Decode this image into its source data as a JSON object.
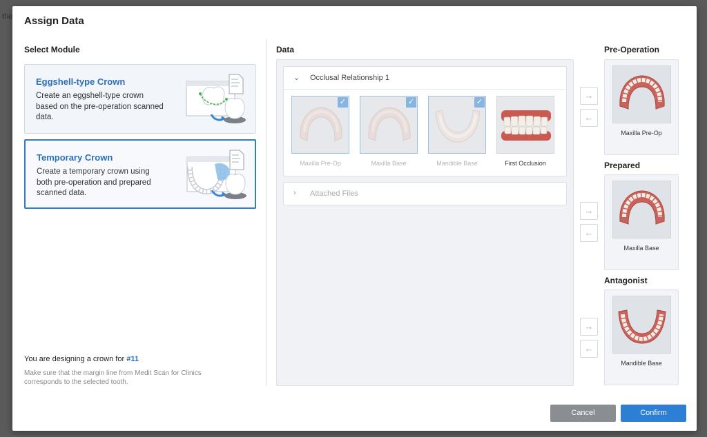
{
  "background": {
    "text": "the"
  },
  "dialog": {
    "title": "Assign Data",
    "select_module": {
      "heading": "Select Module",
      "modules": [
        {
          "name": "Eggshell-type Crown",
          "description": "Create an eggshell-type crown based on the pre-operation scanned data.",
          "selected": false
        },
        {
          "name": "Temporary Crown",
          "description": "Create a temporary crown using both pre-operation and prepared scanned data.",
          "selected": true
        }
      ],
      "designing_prefix": "You are designing a crown for ",
      "tooth": "#11",
      "note": "Make sure that the margin line from Medit Scan for Clinics corresponds to the selected tooth."
    },
    "data": {
      "heading": "Data",
      "groups": [
        {
          "label": "Occlusal Relationship 1",
          "expanded": true,
          "items": [
            {
              "label": "Maxilla Pre-Op",
              "checked": true
            },
            {
              "label": "Maxilla Base",
              "checked": true
            },
            {
              "label": "Mandible Base",
              "checked": true
            },
            {
              "label": "First Occlusion",
              "checked": false
            }
          ]
        },
        {
          "label": "Attached Files",
          "expanded": false
        }
      ]
    },
    "slots": [
      {
        "heading": "Pre-Operation",
        "assigned": "Maxilla Pre-Op"
      },
      {
        "heading": "Prepared",
        "assigned": "Maxilla Base"
      },
      {
        "heading": "Antagonist",
        "assigned": "Mandible Base"
      }
    ],
    "icons": {
      "assign": "arrow-right-icon",
      "unassign": "arrow-left-icon",
      "expanded": "chevron-down-icon",
      "collapsed": "chevron-right-icon",
      "checkbox": "checkmark-icon"
    },
    "buttons": {
      "cancel": "Cancel",
      "confirm": "Confirm"
    },
    "colors": {
      "accent": "#2d7fd6",
      "cancel": "#8a8e93",
      "module_title": "#2a70b8"
    }
  }
}
